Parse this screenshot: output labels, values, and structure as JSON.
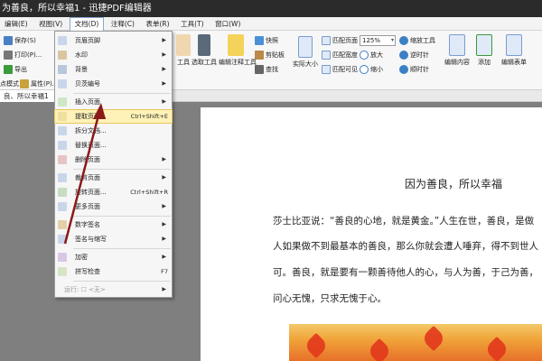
{
  "window": {
    "title": "为善良，所以幸福1 - 迅捷PDF编辑器"
  },
  "menubar": {
    "items": [
      "编辑(E)",
      "视图(V)",
      "文档(D)",
      "注释(C)",
      "表单(R)",
      "工具(T)",
      "窗口(W)"
    ],
    "active_index": 2
  },
  "ribbon": {
    "left": [
      "保存(S)",
      "打印(P)...",
      "导出",
      "点模式",
      "属性(P)..."
    ],
    "tools": [
      "快照",
      "剪贴板",
      "查找"
    ],
    "big": [
      "工具",
      "选取工具",
      "编辑注释工具",
      "实际大小"
    ],
    "fit": [
      "匹配页面",
      "匹配宽度",
      "匹配可见"
    ],
    "zoom_value": "125%",
    "zoom": [
      "放大",
      "缩小"
    ],
    "rotate": [
      "缩放工具",
      "逆时针",
      "顺时针"
    ],
    "edit": [
      "编辑内容",
      "添加",
      "编辑表单"
    ]
  },
  "tab": {
    "label": "良、所以幸福1"
  },
  "doc_menu": {
    "items": [
      {
        "label": "页眉页脚",
        "shortcut": "",
        "submenu": true,
        "disabled": false,
        "highlighted": false
      },
      {
        "label": "水印",
        "shortcut": "",
        "submenu": true,
        "disabled": false,
        "highlighted": false
      },
      {
        "label": "背景",
        "shortcut": "",
        "submenu": true,
        "disabled": false,
        "highlighted": false
      },
      {
        "label": "贝茨编号",
        "shortcut": "",
        "submenu": true,
        "disabled": false,
        "highlighted": false
      },
      {
        "label": "插入页面",
        "shortcut": "",
        "submenu": true,
        "disabled": false,
        "highlighted": false
      },
      {
        "label": "提取页面...",
        "shortcut": "Ctrl+Shift+E",
        "submenu": false,
        "disabled": false,
        "highlighted": true
      },
      {
        "label": "拆分文档...",
        "shortcut": "",
        "submenu": false,
        "disabled": false,
        "highlighted": false
      },
      {
        "label": "替换页面...",
        "shortcut": "",
        "submenu": false,
        "disabled": false,
        "highlighted": false
      },
      {
        "label": "删除页面",
        "shortcut": "",
        "submenu": true,
        "disabled": false,
        "highlighted": false
      },
      {
        "label": "裁剪页面",
        "shortcut": "",
        "submenu": true,
        "disabled": false,
        "highlighted": false
      },
      {
        "label": "旋转页面...",
        "shortcut": "Ctrl+Shift+R",
        "submenu": false,
        "disabled": false,
        "highlighted": false
      },
      {
        "label": "更多页面",
        "shortcut": "",
        "submenu": true,
        "disabled": false,
        "highlighted": false
      },
      {
        "label": "数字签名",
        "shortcut": "",
        "submenu": true,
        "disabled": false,
        "highlighted": false
      },
      {
        "label": "签名与缩写",
        "shortcut": "",
        "submenu": true,
        "disabled": false,
        "highlighted": false
      },
      {
        "label": "加密",
        "shortcut": "",
        "submenu": true,
        "disabled": false,
        "highlighted": false
      },
      {
        "label": "拼写检查",
        "shortcut": "F7",
        "submenu": false,
        "disabled": false,
        "highlighted": false
      },
      {
        "label": "运行: ☐ <无>",
        "shortcut": "",
        "submenu": true,
        "disabled": true,
        "highlighted": false
      }
    ]
  },
  "document": {
    "title": "因为善良，所以幸福",
    "lines": [
      "莎士比亚说：“善良的心地，就是黄金。”人生在世，善良，是做",
      "人如果做不到最基本的善良，那么你就会遭人唾弃，得不到世人",
      "可。善良，就是要有一颗善待他人的心，与人为善，于己为善，",
      "问心无愧，只求无愧于心。"
    ]
  },
  "colors": {
    "accent": "#2f6fc4",
    "highlight": "#fff2b8",
    "arrow": "#8b1a1a"
  }
}
